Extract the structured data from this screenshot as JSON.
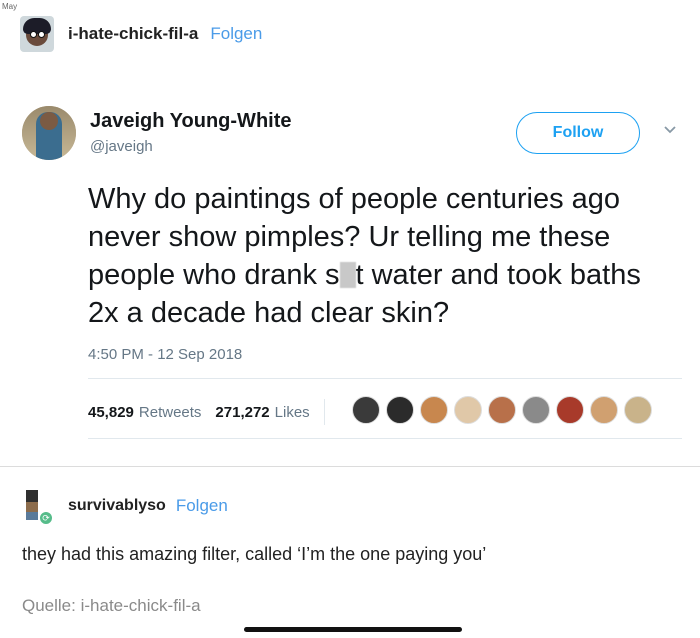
{
  "corner_tag": "May",
  "post": {
    "username": "i-hate-chick-fil-a",
    "follow_label": "Folgen"
  },
  "tweet": {
    "name": "Javeigh Young-White",
    "handle": "@javeigh",
    "follow_label": "Follow",
    "text_part1": "Why do paintings of people centuries ago never show pimples? Ur telling me these people who drank s",
    "text_part2": "t water and took baths 2x a decade had clear skin?",
    "timestamp": "4:50 PM - 12 Sep 2018",
    "retweets_count": "45,829",
    "retweets_label": "Retweets",
    "likes_count": "271,272",
    "likes_label": "Likes",
    "liker_colors": [
      "#3a3a3a",
      "#2b2b2b",
      "#c8874e",
      "#e0c8a8",
      "#b8704a",
      "#8a8a8a",
      "#a83a2a",
      "#d0a070",
      "#c9b38a"
    ]
  },
  "reblog": {
    "username": "survivablyso",
    "follow_label": "Folgen",
    "text": "they had this amazing filter, called ‘I’m the one paying you’",
    "source_label": "Quelle:",
    "source_name": "i-hate-chick-fil-a"
  },
  "colors": {
    "twitter_blue": "#1da1f2",
    "tumblr_link": "#4a9be8",
    "reblog_green": "#56bc8a"
  }
}
